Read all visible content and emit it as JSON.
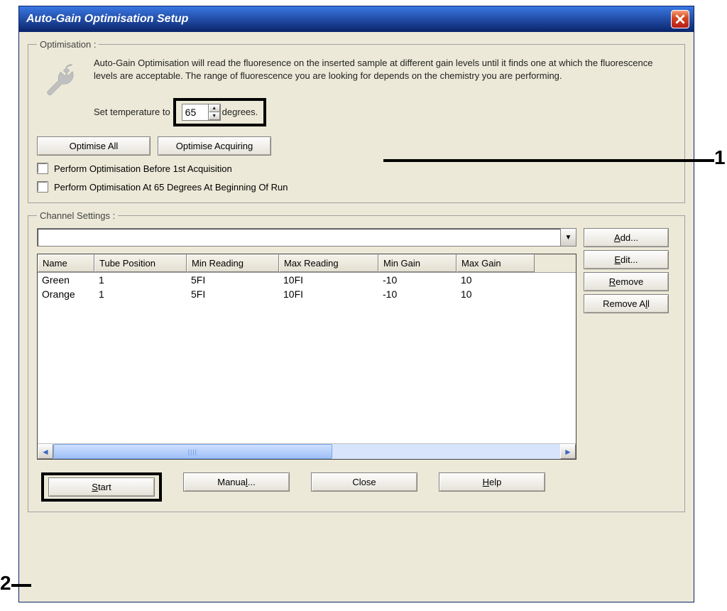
{
  "callouts": {
    "one": "1",
    "two": "2"
  },
  "window": {
    "title": "Auto-Gain Optimisation Setup"
  },
  "optimisation": {
    "legend": "Optimisation :",
    "description": "Auto-Gain Optimisation will read the fluoresence on the inserted sample at different gain levels until it finds one at which the fluorescence levels are acceptable. The range of fluorescence you are looking for depends on the chemistry you are performing.",
    "temp_prefix": "Set temperature to",
    "temp_value": "65",
    "temp_suffix": "degrees.",
    "optimise_all": "Optimise All",
    "optimise_acq": "Optimise Acquiring",
    "check1": "Perform Optimisation Before 1st Acquisition",
    "check2": "Perform Optimisation At 65 Degrees At Beginning Of Run"
  },
  "channel": {
    "legend": "Channel Settings :",
    "columns": {
      "name": "Name",
      "tube": "Tube Position",
      "minr": "Min Reading",
      "maxr": "Max Reading",
      "ming": "Min Gain",
      "maxg": "Max Gain"
    },
    "rows": [
      {
        "name": "Green",
        "tube": "1",
        "minr": "5FI",
        "maxr": "10FI",
        "ming": "-10",
        "maxg": "10"
      },
      {
        "name": "Orange",
        "tube": "1",
        "minr": "5FI",
        "maxr": "10FI",
        "ming": "-10",
        "maxg": "10"
      }
    ],
    "side": {
      "add_pre": "",
      "add_ul": "A",
      "add_post": "dd...",
      "edit_pre": "",
      "edit_ul": "E",
      "edit_post": "dit...",
      "remove_pre": "",
      "remove_ul": "R",
      "remove_post": "emove",
      "removeall_pre": "Remove A",
      "removeall_ul": "l",
      "removeall_post": "l"
    }
  },
  "bottom": {
    "start_pre": "",
    "start_ul": "S",
    "start_post": "tart",
    "manual_pre": "Manua",
    "manual_ul": "l",
    "manual_post": "...",
    "close": "Close",
    "help_pre": "",
    "help_ul": "H",
    "help_post": "elp"
  }
}
